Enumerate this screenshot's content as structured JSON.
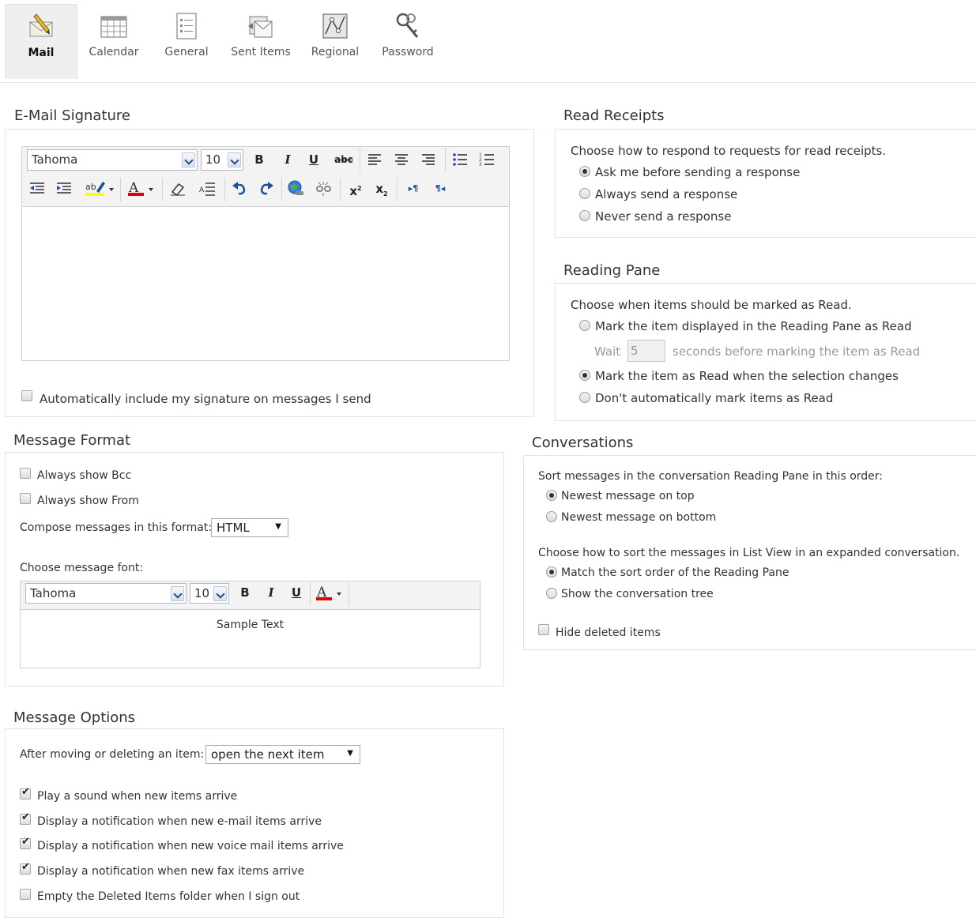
{
  "tabs": [
    {
      "label": "Mail",
      "icon": "mail-pen-icon",
      "active": true
    },
    {
      "label": "Calendar",
      "icon": "calendar-icon",
      "active": false
    },
    {
      "label": "General",
      "icon": "general-list-icon",
      "active": false
    },
    {
      "label": "Sent Items",
      "icon": "sent-items-icon",
      "active": false
    },
    {
      "label": "Regional",
      "icon": "regional-map-icon",
      "active": false
    },
    {
      "label": "Password",
      "icon": "keys-icon",
      "active": false
    }
  ],
  "signature": {
    "title": "E-Mail Signature",
    "font": "Tahoma",
    "size": "10",
    "auto_include_label": "Automatically include my signature on messages I send",
    "auto_include": false
  },
  "message_format": {
    "title": "Message Format",
    "always_bcc_label": "Always show Bcc",
    "always_bcc": false,
    "always_from_label": "Always show From",
    "always_from": false,
    "compose_label": "Compose messages in this format:",
    "compose_value": "HTML",
    "font_label": "Choose message font:",
    "font": "Tahoma",
    "size": "10",
    "sample_text": "Sample Text"
  },
  "message_options": {
    "title": "Message Options",
    "after_move_label": "After moving or deleting an item:",
    "after_move_value": "open the next item",
    "items": [
      {
        "label": "Play a sound when new items arrive",
        "checked": true
      },
      {
        "label": "Display a notification when new e-mail items arrive",
        "checked": true
      },
      {
        "label": "Display a notification when new voice mail items arrive",
        "checked": true
      },
      {
        "label": "Display a notification when new fax items arrive",
        "checked": true
      },
      {
        "label": "Empty the Deleted Items folder when I sign out",
        "checked": false
      }
    ]
  },
  "read_receipts": {
    "title": "Read Receipts",
    "prompt": "Choose how to respond to requests for read receipts.",
    "options": [
      {
        "label": "Ask me before sending a response",
        "selected": true
      },
      {
        "label": "Always send a response",
        "selected": false
      },
      {
        "label": "Never send a response",
        "selected": false
      }
    ]
  },
  "reading_pane": {
    "title": "Reading Pane",
    "prompt": "Choose when items should be marked as Read.",
    "option1": "Mark the item displayed in the Reading Pane as Read",
    "wait_label": "Wait",
    "wait_value": "5",
    "wait_suffix": "seconds before marking the item as Read",
    "option2": "Mark the item as Read when the selection changes",
    "option3": "Don't automatically mark items as Read",
    "selected": 2
  },
  "conversations": {
    "title": "Conversations",
    "sort_prompt": "Sort messages in the conversation Reading Pane in this order:",
    "sort_newest_top": "Newest message on top",
    "sort_newest_bottom": "Newest message on bottom",
    "list_prompt": "Choose how to sort the messages in List View in an expanded conversation.",
    "list_match": "Match the sort order of the Reading Pane",
    "list_tree": "Show the conversation tree",
    "hide_deleted_label": "Hide deleted items",
    "hide_deleted": false
  },
  "colors": {
    "text": "#333333",
    "border": "#e3e3e3",
    "toolbar": "#f3f3f3",
    "highlight_yellow": "#ffff00",
    "font_red": "#e00000"
  }
}
